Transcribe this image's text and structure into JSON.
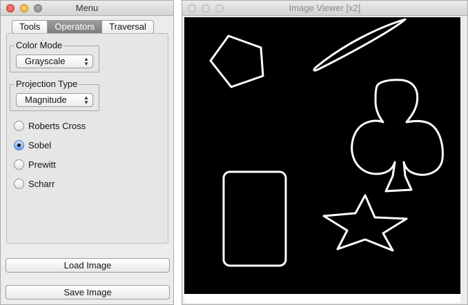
{
  "menu_window": {
    "title": "Menu",
    "tabs": [
      {
        "label": "Tools",
        "active": false
      },
      {
        "label": "Operators",
        "active": true
      },
      {
        "label": "Traversal",
        "active": false
      }
    ],
    "color_mode": {
      "label": "Color Mode",
      "value": "Grayscale"
    },
    "projection_type": {
      "label": "Projection Type",
      "value": "Magnitude"
    },
    "operators": [
      {
        "label": "Roberts Cross",
        "checked": false
      },
      {
        "label": "Sobel",
        "checked": true
      },
      {
        "label": "Prewitt",
        "checked": false
      },
      {
        "label": "Scharr",
        "checked": false
      }
    ],
    "load_button": "Load Image",
    "save_button": "Save Image"
  },
  "viewer_window": {
    "title": "Image Viewer [x2]",
    "image_shapes": [
      "pentagon",
      "ellipse",
      "club",
      "rounded-rectangle",
      "star"
    ]
  },
  "colors": {
    "canvas_background": "#000000",
    "edge_color": "#ffffff",
    "radio_selected": "#6a9be8",
    "tab_active": "#8a8a8a"
  }
}
